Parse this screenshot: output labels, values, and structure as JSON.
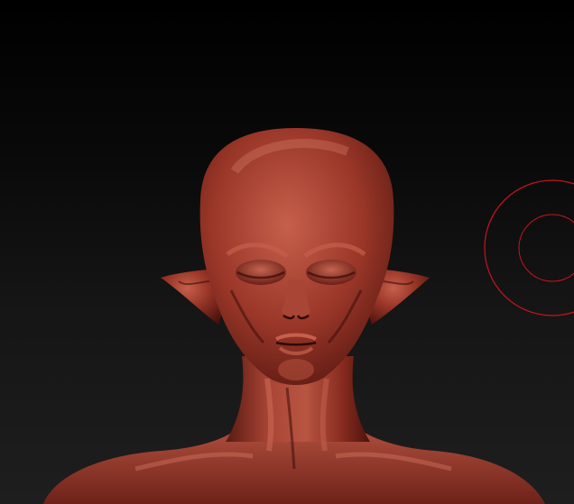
{
  "viewport": {
    "background_top": "#000000",
    "background_bottom": "#1e1e1e"
  },
  "model": {
    "material_color": "#8e2e22",
    "highlight_color": "#c6604c",
    "shadow_color": "#3c0d09"
  },
  "brush_cursor": {
    "icon": "brush-circle-icon",
    "color": "#c8141e"
  }
}
